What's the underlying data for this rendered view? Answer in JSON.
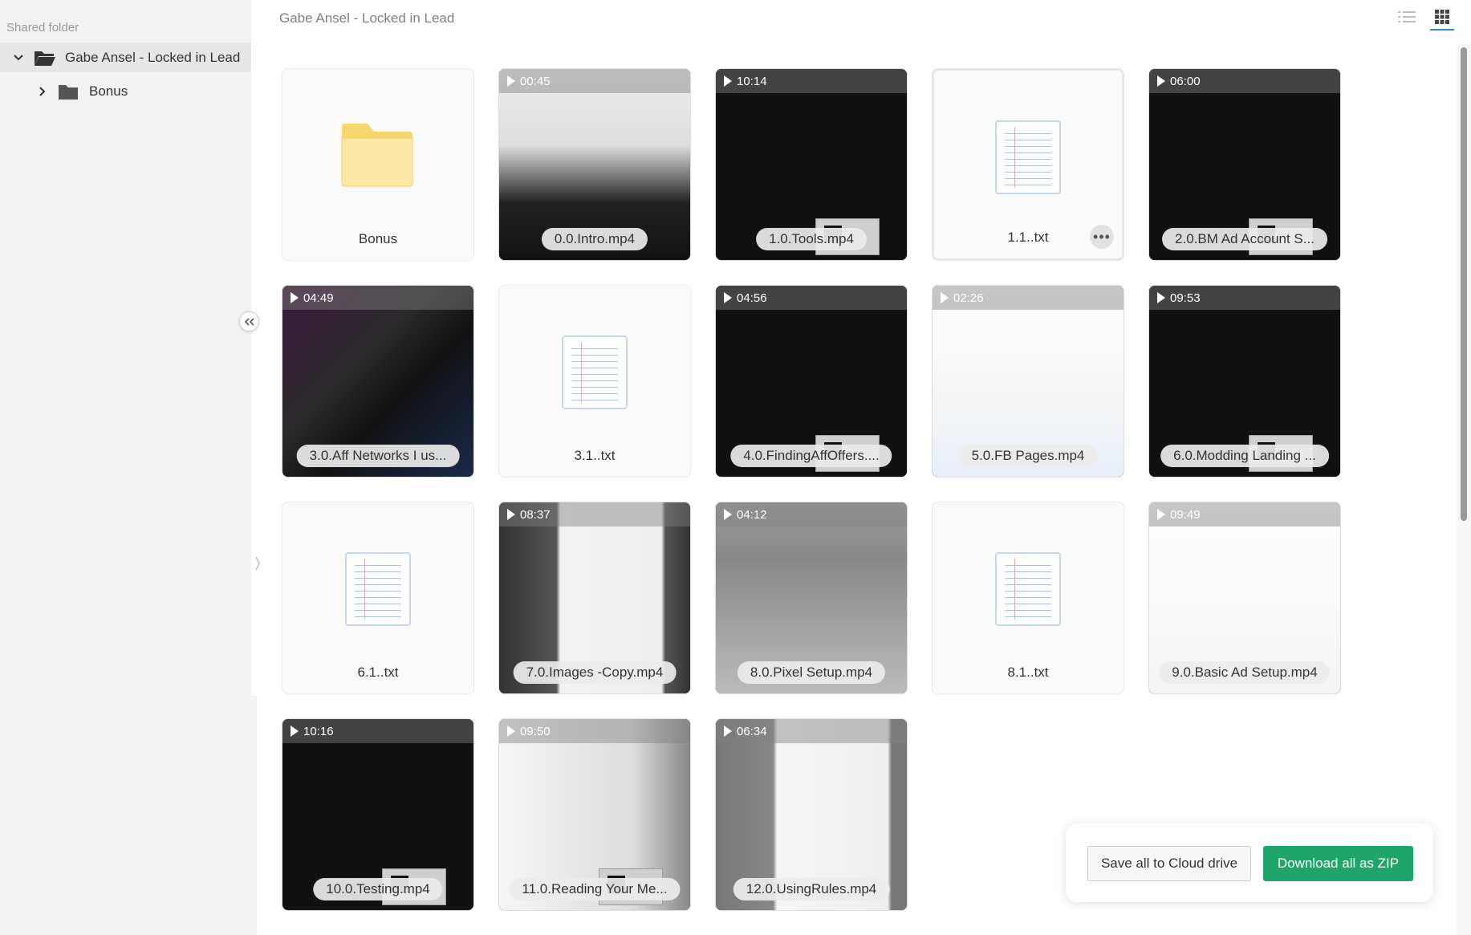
{
  "sidebar": {
    "section_label": "Shared folder",
    "root": {
      "label": "Gabe Ansel - Locked in Lead",
      "icon": "folder-open-icon",
      "expanded": true
    },
    "children": [
      {
        "label": "Bonus",
        "icon": "folder-icon",
        "expanded": false
      }
    ]
  },
  "header": {
    "title": "Gabe Ansel - Locked in Lead",
    "view_modes": [
      "list-view-icon",
      "grid-view-icon"
    ],
    "active_view": "grid"
  },
  "items": [
    {
      "name": "Bonus",
      "type": "folder"
    },
    {
      "name": "0.0.Intro.mp4",
      "type": "video",
      "duration": "00:45"
    },
    {
      "name": "1.0.Tools.mp4",
      "type": "video",
      "duration": "10:14"
    },
    {
      "name": "1.1..txt",
      "type": "text",
      "selected": true
    },
    {
      "name": "2.0.BM Ad Account S...",
      "type": "video",
      "duration": "06:00"
    },
    {
      "name": "3.0.Aff Networks I us...",
      "type": "video",
      "duration": "04:49"
    },
    {
      "name": "3.1..txt",
      "type": "text"
    },
    {
      "name": "4.0.FindingAffOffers....",
      "type": "video",
      "duration": "04:56"
    },
    {
      "name": "5.0.FB Pages.mp4",
      "type": "video",
      "duration": "02:26"
    },
    {
      "name": "6.0.Modding Landing ...",
      "type": "video",
      "duration": "09:53"
    },
    {
      "name": "6.1..txt",
      "type": "text"
    },
    {
      "name": "7.0.Images -Copy.mp4",
      "type": "video",
      "duration": "08:37"
    },
    {
      "name": "8.0.Pixel Setup.mp4",
      "type": "video",
      "duration": "04:12"
    },
    {
      "name": "8.1..txt",
      "type": "text"
    },
    {
      "name": "9.0.Basic Ad Setup.mp4",
      "type": "video",
      "duration": "09:49"
    },
    {
      "name": "10.0.Testing.mp4",
      "type": "video",
      "duration": "10:16"
    },
    {
      "name": "11.0.Reading Your Me...",
      "type": "video",
      "duration": "09:50"
    },
    {
      "name": "12.0.UsingRules.mp4",
      "type": "video",
      "duration": "06:34"
    }
  ],
  "actions": {
    "save_label": "Save all to Cloud drive",
    "download_label": "Download all as ZIP"
  },
  "colors": {
    "accent": "#1fa56a",
    "active_view_underline": "#2b86c5",
    "sidebar_bg": "#f2f2f2"
  }
}
